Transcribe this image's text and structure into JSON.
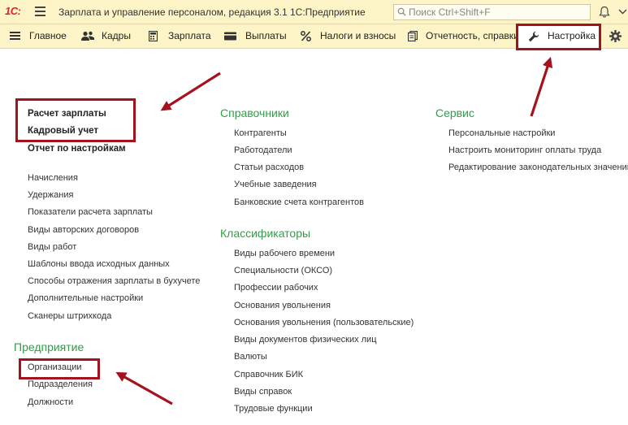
{
  "app": {
    "logo": "1С:",
    "title": "Зарплата и управление персоналом, редакция 3.1 1С:Предприятие",
    "search_placeholder": "Поиск Ctrl+Shift+F"
  },
  "menu": [
    {
      "id": "main",
      "label": "Главное",
      "icon": "hamburger-icon"
    },
    {
      "id": "staff",
      "label": "Кадры",
      "icon": "people-icon"
    },
    {
      "id": "salary",
      "label": "Зарплата",
      "icon": "calculator-icon"
    },
    {
      "id": "payments",
      "label": "Выплаты",
      "icon": "wallet-icon"
    },
    {
      "id": "taxes",
      "label": "Налоги и взносы",
      "icon": "percent-icon"
    },
    {
      "id": "reports",
      "label": "Отчетность, справки",
      "icon": "documents-icon"
    },
    {
      "id": "settings",
      "label": "Настройка",
      "icon": "wrench-icon",
      "active": true
    }
  ],
  "left": {
    "top_links": [
      "Расчет зарплаты",
      "Кадровый учет",
      "Отчет по настройкам"
    ],
    "links": [
      "Начисления",
      "Удержания",
      "Показатели расчета зарплаты",
      "Виды авторских договоров",
      "Виды работ",
      "Шаблоны ввода исходных данных",
      "Способы отражения зарплаты в бухучете",
      "Дополнительные настройки",
      "Сканеры штрихкода"
    ],
    "enterprise": {
      "title": "Предприятие",
      "links": [
        "Организации",
        "Подразделения",
        "Должности"
      ]
    }
  },
  "middle": {
    "directories": {
      "title": "Справочники",
      "links": [
        "Контрагенты",
        "Работодатели",
        "Статьи расходов",
        "Учебные заведения",
        "Банковские счета контрагентов"
      ]
    },
    "classifiers": {
      "title": "Классификаторы",
      "links": [
        "Виды рабочего времени",
        "Специальности (ОКСО)",
        "Профессии рабочих",
        "Основания увольнения",
        "Основания увольнения (пользовательские)",
        "Виды документов физических лиц",
        "Валюты",
        "Справочник БИК",
        "Виды справок",
        "Трудовые функции"
      ]
    }
  },
  "right": {
    "service": {
      "title": "Сервис",
      "links": [
        "Персональные настройки",
        "Настроить мониторинг оплаты труда",
        "Редактирование законодательных значений"
      ]
    }
  },
  "colors": {
    "toolbar_bg": "#fdf5c7",
    "section_title": "#2e9f47",
    "annotation": "#a4121e",
    "logo": "#d7262c"
  }
}
